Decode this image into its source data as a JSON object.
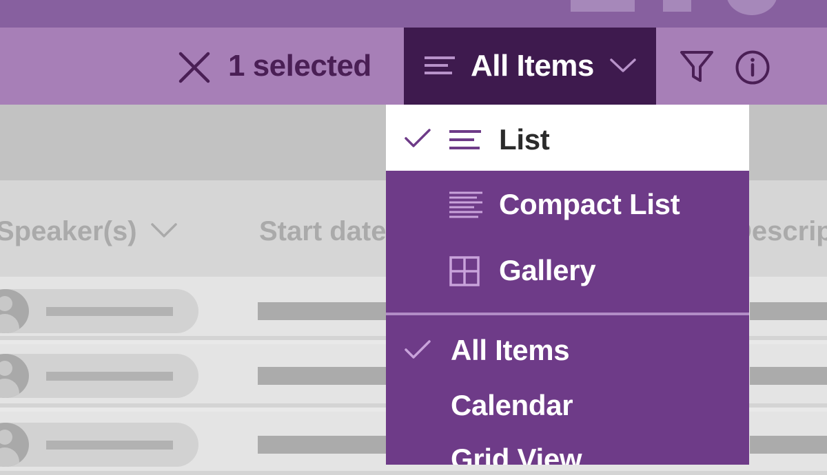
{
  "toolbar": {
    "selection_text": "1 selected",
    "view_button_label": "All Items"
  },
  "columns": {
    "speaker": "Speaker(s)",
    "start_date": "Start date",
    "description": "Descript"
  },
  "view_menu": {
    "layouts": [
      {
        "label": "List",
        "icon": "list-lines-icon",
        "selected": true
      },
      {
        "label": "Compact List",
        "icon": "compact-list-icon",
        "selected": false
      },
      {
        "label": "Gallery",
        "icon": "gallery-grid-icon",
        "selected": false
      }
    ],
    "views": [
      {
        "label": "All Items",
        "selected": true
      },
      {
        "label": "Calendar",
        "selected": false
      },
      {
        "label": "Grid View",
        "selected": false
      }
    ]
  },
  "colors": {
    "title_bar": "#87609f",
    "command_bar": "#a77fb7",
    "view_button": "#3e1a4e",
    "menu_bg": "#6e3b88",
    "accent": "#6e3b88"
  }
}
